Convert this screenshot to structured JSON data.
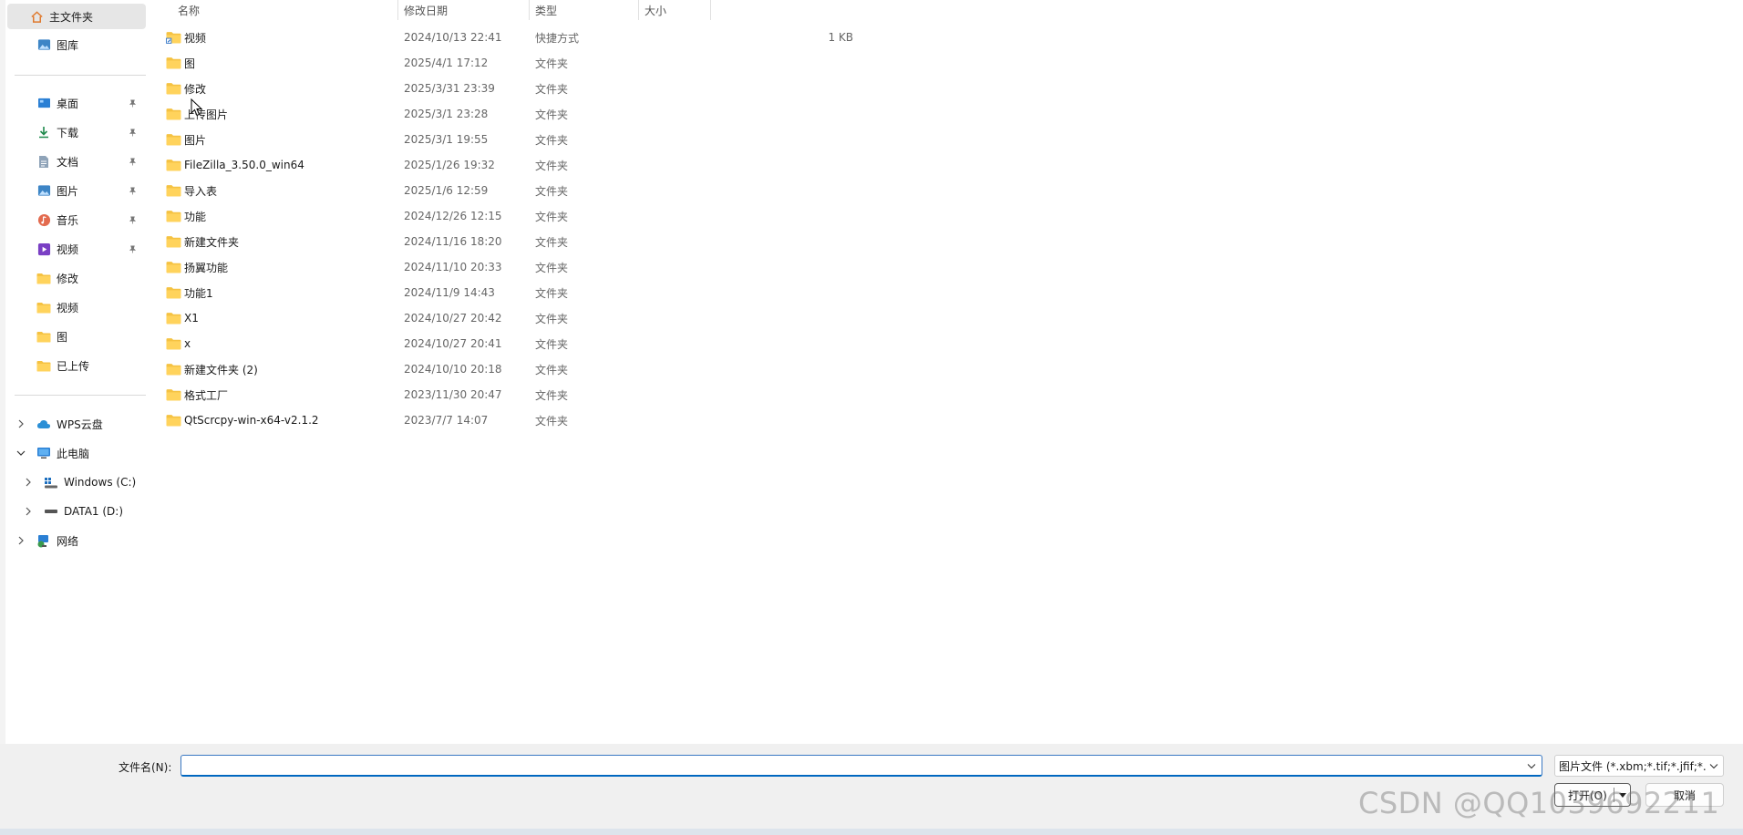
{
  "sidebar": {
    "quick": [
      {
        "label": "主文件夹",
        "icon": "home-icon",
        "selected": true
      },
      {
        "label": "图库",
        "icon": "gallery-icon"
      }
    ],
    "pinned": [
      {
        "label": "桌面",
        "icon": "desktop-icon",
        "pinned": true
      },
      {
        "label": "下载",
        "icon": "download-icon",
        "pinned": true
      },
      {
        "label": "文档",
        "icon": "document-icon",
        "pinned": true
      },
      {
        "label": "图片",
        "icon": "pictures-icon",
        "pinned": true
      },
      {
        "label": "音乐",
        "icon": "music-icon",
        "pinned": true
      },
      {
        "label": "视频",
        "icon": "videos-icon",
        "pinned": true
      },
      {
        "label": "修改",
        "icon": "folder-icon"
      },
      {
        "label": "视频",
        "icon": "folder-icon"
      },
      {
        "label": "图",
        "icon": "folder-icon"
      },
      {
        "label": "已上传",
        "icon": "folder-icon"
      }
    ],
    "tree": [
      {
        "label": "WPS云盘",
        "icon": "cloud-icon",
        "expanded": false
      },
      {
        "label": "此电脑",
        "icon": "computer-icon",
        "expanded": true
      },
      {
        "label": "Windows (C:)",
        "icon": "drive-c-icon",
        "expanded": false
      },
      {
        "label": "DATA1 (D:)",
        "icon": "drive-d-icon",
        "expanded": false
      },
      {
        "label": "网络",
        "icon": "network-icon",
        "expanded": false
      }
    ]
  },
  "columns": {
    "name": "名称",
    "date": "修改日期",
    "type": "类型",
    "size": "大小"
  },
  "files": [
    {
      "name": "视频",
      "date": "2024/10/13 22:41",
      "type": "快捷方式",
      "size": "1 KB",
      "shortcut": true
    },
    {
      "name": "图",
      "date": "2025/4/1 17:12",
      "type": "文件夹",
      "size": ""
    },
    {
      "name": "修改",
      "date": "2025/3/31 23:39",
      "type": "文件夹",
      "size": ""
    },
    {
      "name": "上传图片",
      "date": "2025/3/1 23:28",
      "type": "文件夹",
      "size": ""
    },
    {
      "name": "图片",
      "date": "2025/3/1 19:55",
      "type": "文件夹",
      "size": ""
    },
    {
      "name": "FileZilla_3.50.0_win64",
      "date": "2025/1/26 19:32",
      "type": "文件夹",
      "size": ""
    },
    {
      "name": "导入表",
      "date": "2025/1/6 12:59",
      "type": "文件夹",
      "size": ""
    },
    {
      "name": "功能",
      "date": "2024/12/26 12:15",
      "type": "文件夹",
      "size": ""
    },
    {
      "name": "新建文件夹",
      "date": "2024/11/16 18:20",
      "type": "文件夹",
      "size": ""
    },
    {
      "name": "扬翼功能",
      "date": "2024/11/10 20:33",
      "type": "文件夹",
      "size": ""
    },
    {
      "name": "功能1",
      "date": "2024/11/9 14:43",
      "type": "文件夹",
      "size": ""
    },
    {
      "name": "X1",
      "date": "2024/10/27 20:42",
      "type": "文件夹",
      "size": ""
    },
    {
      "name": "x",
      "date": "2024/10/27 20:41",
      "type": "文件夹",
      "size": ""
    },
    {
      "name": "新建文件夹 (2)",
      "date": "2024/10/10 20:18",
      "type": "文件夹",
      "size": ""
    },
    {
      "name": "格式工厂",
      "date": "2023/11/30 20:47",
      "type": "文件夹",
      "size": ""
    },
    {
      "name": "QtScrcpy-win-x64-v2.1.2",
      "date": "2023/7/7 14:07",
      "type": "文件夹",
      "size": ""
    }
  ],
  "bottom": {
    "filename_label": "文件名(N):",
    "filename_value": "",
    "filter": "图片文件 (*.xbm;*.tif;*.jfif;*.pjp",
    "open_label": "打开(O)",
    "cancel_label": "取消"
  },
  "watermark": "CSDN @QQ1039692211",
  "colors": {
    "accent": "#0067c0",
    "folder": "#f5c242",
    "selected_bg": "#e6e6e6"
  }
}
